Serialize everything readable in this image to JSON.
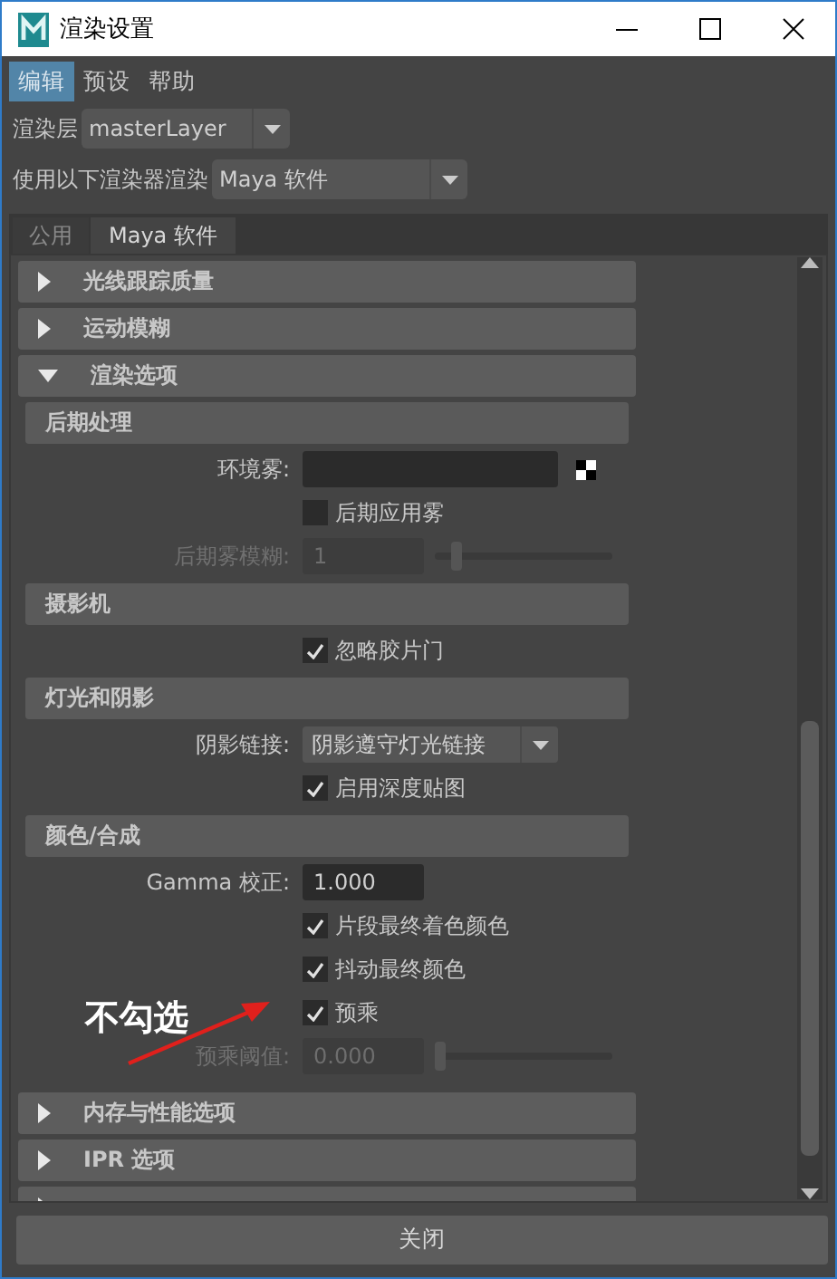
{
  "window": {
    "title": "渲染设置"
  },
  "menu": [
    {
      "label": "编辑",
      "selected": true
    },
    {
      "label": "预设",
      "selected": false
    },
    {
      "label": "帮助",
      "selected": false
    }
  ],
  "render_layer": {
    "label": "渲染层",
    "value": "masterLayer"
  },
  "renderer": {
    "label": "使用以下渲染器渲染",
    "value": "Maya 软件"
  },
  "tabs": [
    {
      "label": "公用",
      "selected": false
    },
    {
      "label": "Maya 软件",
      "selected": true
    }
  ],
  "sections": [
    {
      "title": "光线跟踪质量",
      "expanded": false
    },
    {
      "title": "运动模糊",
      "expanded": false
    },
    {
      "title": "渲染选项",
      "expanded": true,
      "groups": [
        {
          "title": "后期处理",
          "rows": [
            {
              "kind": "color",
              "label": "环境雾:"
            },
            {
              "kind": "checkbox",
              "label": "后期应用雾",
              "checked": false
            },
            {
              "kind": "slider",
              "label": "后期雾模糊:",
              "value": "1",
              "level": 0.1,
              "disabled": true
            }
          ]
        },
        {
          "title": "摄影机",
          "rows": [
            {
              "kind": "checkbox",
              "label": "忽略胶片门",
              "checked": true
            }
          ]
        },
        {
          "title": "灯光和阴影",
          "rows": [
            {
              "kind": "dropdown",
              "label": "阴影链接:",
              "value": "阴影遵守灯光链接"
            },
            {
              "kind": "checkbox",
              "label": "启用深度贴图",
              "checked": true
            }
          ]
        },
        {
          "title": "颜色/合成",
          "rows": [
            {
              "kind": "number",
              "label": "Gamma 校正:",
              "value": "1.000"
            },
            {
              "kind": "checkbox",
              "label": "片段最终着色颜色",
              "checked": true
            },
            {
              "kind": "checkbox",
              "label": "抖动最终颜色",
              "checked": true
            },
            {
              "kind": "checkbox",
              "label": "预乘",
              "checked": true
            },
            {
              "kind": "slider",
              "label": "预乘阈值:",
              "value": "0.000",
              "level": 0,
              "disabled": true
            }
          ]
        }
      ]
    },
    {
      "title": "内存与性能选项",
      "expanded": false
    },
    {
      "title": "IPR 选项",
      "expanded": false
    },
    {
      "expanded": false
    }
  ],
  "annotation": {
    "text": "不勾选"
  },
  "close_button": "关闭"
}
